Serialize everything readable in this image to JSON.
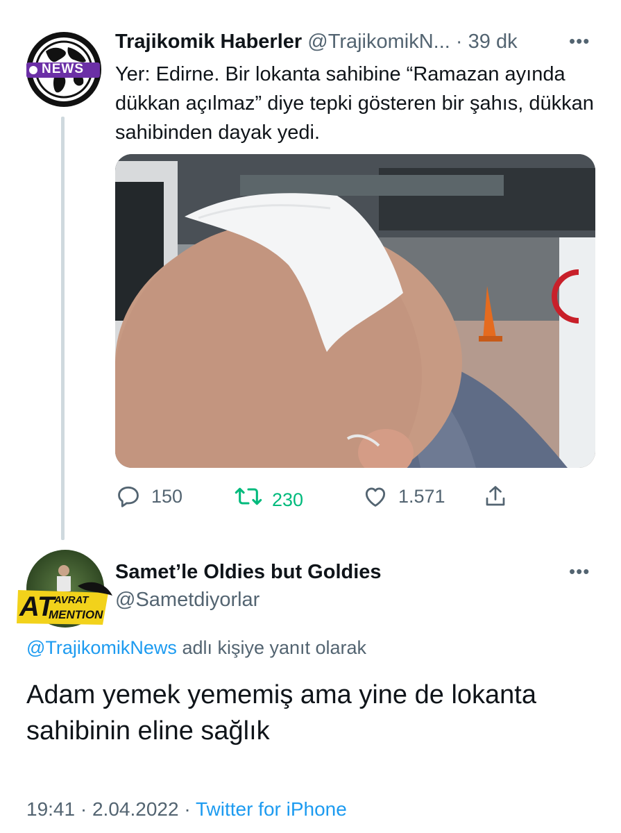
{
  "tweet": {
    "author_name": "Trajikomik Haberler",
    "author_handle": "@TrajikomikN...",
    "separator": "·",
    "time_ago": "39 dk",
    "more_label": "•••",
    "avatar_badge": "NEWS",
    "text": "Yer: Edirne. Bir lokanta sahibine “Ramazan ayında dükkan açılmaz” diye tepki gösteren bir şahıs, dükkan sahibinden dayak yedi.",
    "actions": {
      "reply_count": "150",
      "retweet_count": "230",
      "like_count": "1.571"
    },
    "icons": [
      "reply-icon",
      "retweet-icon",
      "like-icon",
      "share-icon"
    ],
    "retweet_color": "#00ba7c"
  },
  "reply": {
    "author_name": "Samet’le Oldies but Goldies",
    "author_handle": "@Sametdiyorlar",
    "more_label": "•••",
    "avatar_text_top": "AVRAT",
    "avatar_text_big": "AT",
    "avatar_text_bottom": "MENTION",
    "replying_to_handle": "@TrajikomikNews",
    "replying_to_suffix": " adlı kişiye yanıt olarak",
    "text": "Adam yemek yememiş ama yine de lokanta sahibinin eline sağlık",
    "time": "19:41",
    "separator": " · ",
    "date": "2.04.2022",
    "source": "Twitter for iPhone"
  },
  "colors": {
    "link": "#1d9bf0",
    "muted": "#536471",
    "text": "#0f1419"
  }
}
